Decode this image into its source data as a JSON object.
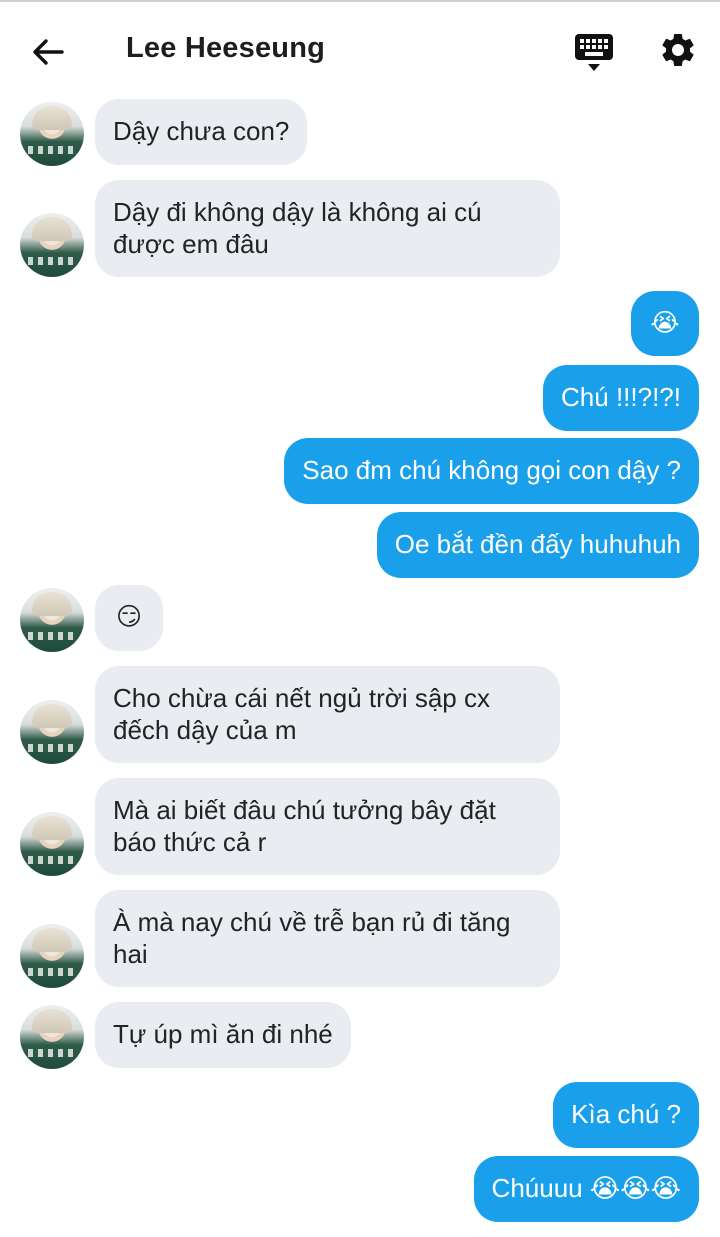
{
  "header": {
    "back_icon": "arrow-left-icon",
    "title": "Lee Heeseung",
    "keyboard_icon": "keyboard-icon",
    "settings_icon": "gear-icon"
  },
  "colors": {
    "incoming_bubble": "#e9ecf0",
    "outgoing_bubble": "#1aa0ea",
    "outgoing_text": "#ffffff"
  },
  "messages": [
    {
      "side": "incoming",
      "text": "Dậy chưa con?"
    },
    {
      "side": "incoming",
      "text": "Dậy đi không dậy là không ai cú\nđược em đâu"
    },
    {
      "side": "outgoing",
      "text": "😭"
    },
    {
      "side": "outgoing",
      "text": "Chú !!!?!?!"
    },
    {
      "side": "outgoing",
      "text": "Sao đm chú không gọi con dậy ?"
    },
    {
      "side": "outgoing",
      "text": "Oe bắt đền đấy huhuhuh"
    },
    {
      "side": "incoming",
      "text": "😏"
    },
    {
      "side": "incoming",
      "text": "Cho chừa cái nết ngủ trời sập cx\nđếch dậy của m"
    },
    {
      "side": "incoming",
      "text": "Mà ai biết đâu chú tưởng bây đặt\nbáo thức cả r"
    },
    {
      "side": "incoming",
      "text": "À mà nay chú về trễ bạn rủ đi tăng\nhai"
    },
    {
      "side": "incoming",
      "text": "Tự úp mì ăn đi nhé"
    },
    {
      "side": "outgoing",
      "text": "Kìa chú ?"
    },
    {
      "side": "outgoing",
      "text": "Chúuuu 😭😭😭"
    }
  ]
}
